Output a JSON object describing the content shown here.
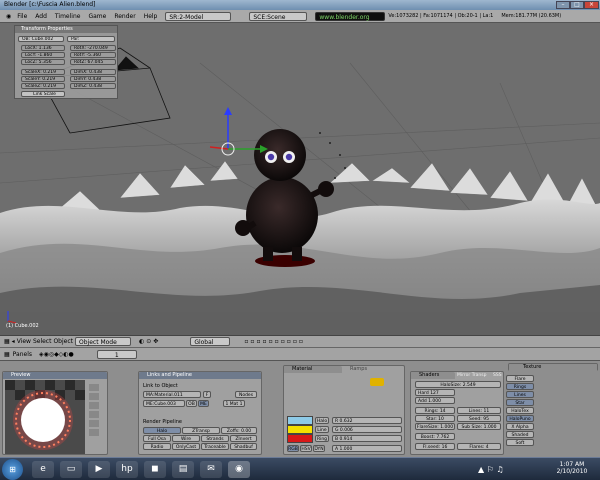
{
  "window": {
    "title": "Blender [c:\\Fuscia Alien.blend]",
    "minimize": "–",
    "maximize": "□",
    "close": "×"
  },
  "menu": {
    "items": [
      "File",
      "Add",
      "Timeline",
      "Game",
      "Render",
      "Help"
    ],
    "screen": "SR:2-Model",
    "scene": "SCE:Scene",
    "url": "www.blender.org 249.2",
    "stats": "Ve:1073282 | Fa:1071174 | Ob:20-1 | La:1",
    "mem": "Mem:181.77M (20.63M)",
    "frame": "Time:1"
  },
  "transform": {
    "title": "Transform Properties",
    "ob": "OB: Cube.002",
    "par": "Par:",
    "loc": [
      "LocX: 1.136",
      "LocY: -1.860",
      "LocZ: 5.356"
    ],
    "rot": [
      "RotX: -270.049",
      "RotY: -5.360",
      "RotZ: 67.045"
    ],
    "scale": [
      "ScaleX: 0.219",
      "ScaleY: 0.219",
      "ScaleZ: 0.219"
    ],
    "dim": [
      "DimX: 0.438",
      "DimY: 0.438",
      "DimZ: 0.438"
    ],
    "link": "Link Scale"
  },
  "viewport": {
    "object_label": "(1) Cube.002"
  },
  "vp_header": {
    "view": "View",
    "select": "Select",
    "object": "Object",
    "mode": "Object Mode",
    "orientation": "Global"
  },
  "btn_header": {
    "panels": "Panels",
    "frame": "1"
  },
  "preview": {
    "title": "Preview"
  },
  "links": {
    "title": "Links and Pipeline",
    "link_label": "Link to Object",
    "ma": "MA:Material.011",
    "f": "F",
    "nodes": "Nodes",
    "me": "ME:Cube.003",
    "ob": "OB",
    "me_btn": "ME",
    "mat": "1 Mat 1",
    "pipeline": "Render Pipeline",
    "row1": [
      "Halo",
      "ZTransp",
      "Zoffs: 0.00"
    ],
    "row2": [
      "Full Osa",
      "Wire",
      "Strands",
      "ZInvert"
    ],
    "row3": [
      "Radio",
      "OnlyCast",
      "Traceable",
      "Shadbuf"
    ]
  },
  "material": {
    "tab1": "Material",
    "tab2": "Ramps",
    "labels": [
      "Halo",
      "Line",
      "Ring"
    ],
    "values": [
      "R 0.632",
      "G 0.006",
      "B 0.914"
    ],
    "alpha": "A 1.000",
    "modes": [
      "RGB",
      "HSV",
      "DYN"
    ],
    "swatch_halo": "#8ecbe8",
    "swatch_line": "#f4e000",
    "swatch_ring": "#d81818"
  },
  "shaders": {
    "tab1": "Shaders",
    "tab2": "Mirror Transp",
    "tab3": "SSS",
    "halosize": "HaloSize: 2.549",
    "hard": "Hard 127",
    "add": "Add 1.000",
    "rings": "Rings: 14",
    "lines": "Lines: 11",
    "star": "Star: 10",
    "seed": "Seed: 95",
    "flare_size": "FlareSize: 1.000",
    "sub_size": "Sub Size: 1.000",
    "boost": "Boost: 7.762",
    "fseed": "Fl.seed: 16",
    "flares": "Flares: 4",
    "side": [
      "Flare",
      "Rings",
      "Lines",
      "Star",
      "HaloTex",
      "HaloPuno",
      "X Alpha",
      "Shaded",
      "Soft"
    ]
  },
  "textures": {
    "tab": "Texture"
  },
  "taskbar": {
    "time": "1:07 AM",
    "date": "2/10/2010"
  }
}
